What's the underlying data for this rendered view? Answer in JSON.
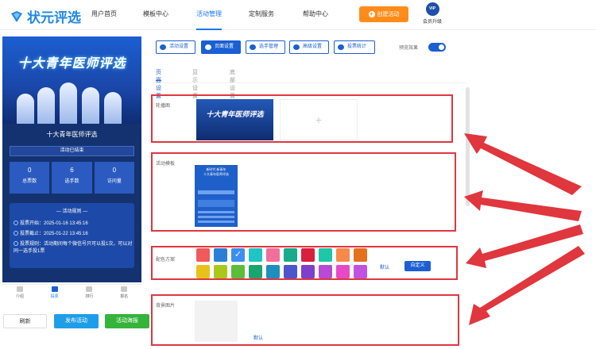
{
  "brand": {
    "name": "状元评选"
  },
  "nav": {
    "items": [
      {
        "label": "用户首页"
      },
      {
        "label": "模板中心"
      },
      {
        "label": "活动管理"
      },
      {
        "label": "定制服务"
      },
      {
        "label": "帮助中心"
      }
    ]
  },
  "header": {
    "create_label": "创建活动",
    "vip_badge": "VIP",
    "vip_label": "会员升级"
  },
  "preview": {
    "banner_title": "十大青年医师评选",
    "title": "十大青年医师评选",
    "status": "活动已结束",
    "stats": [
      {
        "n": "0",
        "l": "总票数"
      },
      {
        "n": "6",
        "l": "选手数"
      },
      {
        "n": "0",
        "l": "访问量"
      }
    ],
    "rules_title": "— 活动规则 —",
    "rules": [
      "投票开始：2025-01-16 13:45:16",
      "投票截止：2025-01-22 13:45:16",
      "投票规则：活动期间每个微信号只可以投1次，可以对同一选手投1票"
    ],
    "tabs": [
      "介绍",
      "投票",
      "排行",
      "报名"
    ]
  },
  "bottom": {
    "refresh": "刷新",
    "publish": "发布活动",
    "poster": "活动海报"
  },
  "settings_tabs": [
    "活动设置",
    "页面设置",
    "选手管理",
    "高级设置",
    "投票统计"
  ],
  "preview_effect": "预览效果",
  "sub_tabs": [
    "页面设置",
    "显示设置",
    "底部设置"
  ],
  "sections": {
    "carousel": {
      "label": "轮播图",
      "img_title": "十大青年医师评选",
      "add": "+"
    },
    "template": {
      "label": "活动模板",
      "img_title": "新时代 新青年\n十大青年医师评选"
    },
    "color": {
      "label": "配色方案",
      "default": "默认",
      "custom": "自定义"
    },
    "background": {
      "label": "背景图片",
      "default": "默认"
    }
  },
  "colors": {
    "row1": [
      "#f05a5a",
      "#2b7fd6",
      "#3a8ff0",
      "#1fc4c4",
      "#f0709a",
      "#1aaa8c",
      "#d81f3d",
      "#1ec7a8",
      "#f78a4a",
      "#e5701e"
    ],
    "row2": [
      "#e8c21a",
      "#a8c81c",
      "#5cbd3a",
      "#1aa56e",
      "#1e8ebd",
      "#4c55c9",
      "#7e3fc9",
      "#b94ad6",
      "#e64ac7",
      "#c052e0"
    ],
    "accent": "#1a5fd3",
    "annotation": "#e0363e"
  }
}
